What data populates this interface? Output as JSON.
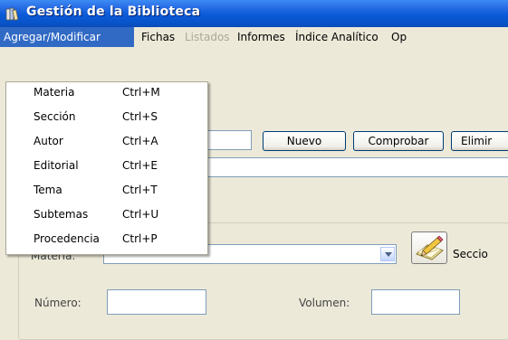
{
  "window": {
    "title": "Gestión de la Biblioteca",
    "icon": "books-icon"
  },
  "menubar": {
    "items": [
      {
        "label": "Agregar/Modificar",
        "state": "active"
      },
      {
        "label": "Fichas",
        "state": "normal"
      },
      {
        "label": "Listados",
        "state": "disabled"
      },
      {
        "label": "Informes",
        "state": "normal"
      },
      {
        "label": "Índice Analítico",
        "state": "normal"
      },
      {
        "label": "Op",
        "state": "normal"
      }
    ]
  },
  "dropdown": {
    "items": [
      {
        "label": "Materia",
        "shortcut": "Ctrl+M"
      },
      {
        "label": "Sección",
        "shortcut": "Ctrl+S"
      },
      {
        "label": "Autor",
        "shortcut": "Ctrl+A"
      },
      {
        "label": "Editorial",
        "shortcut": "Ctrl+E"
      },
      {
        "label": "Tema",
        "shortcut": "Ctrl+T"
      },
      {
        "label": "Subtemas",
        "shortcut": "Ctrl+U"
      },
      {
        "label": "Procedencia",
        "shortcut": "Ctrl+P"
      }
    ]
  },
  "toolbar": {
    "nuevo": "Nuevo",
    "comprobar": "Comprobar",
    "eliminar": "Elimir"
  },
  "form": {
    "materia_label": "Materia:",
    "materia_value": "",
    "seccion_label": "Seccio",
    "numero_label": "Número:",
    "numero_value": "",
    "volumen_label": "Volumen:",
    "volumen_value": ""
  },
  "colors": {
    "titlebar": "#0A5AD8",
    "menu_highlight": "#316AC5",
    "window_bg": "#ECE9D8"
  }
}
